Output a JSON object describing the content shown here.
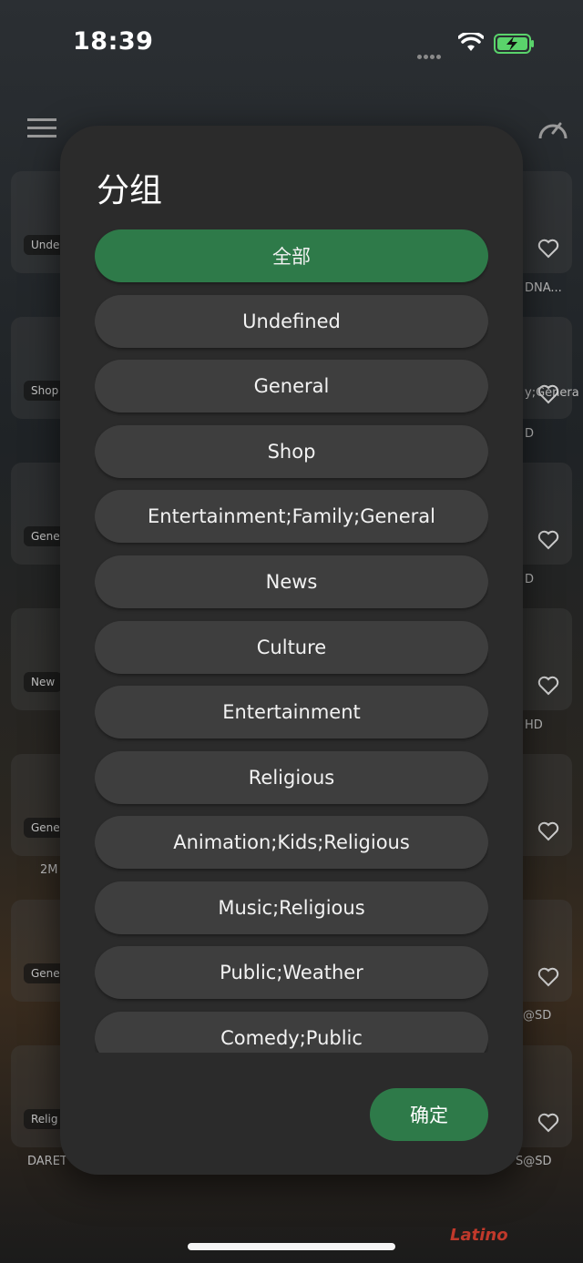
{
  "status_bar": {
    "time": "18:39"
  },
  "background": {
    "tags": [
      "Unde",
      "Shop",
      "Gene",
      "New",
      "Gene",
      "Gene",
      "Relig"
    ],
    "right_texts": [
      "DNA...",
      "y;Genera",
      "D",
      "D",
      "HD",
      "@SD",
      "S@SD"
    ],
    "left_texts": [
      "2M",
      "DARET"
    ],
    "logos": [
      "Latino"
    ]
  },
  "dialog": {
    "title": "分组",
    "options": [
      "全部",
      "Undefined",
      "General",
      "Shop",
      "Entertainment;Family;General",
      "News",
      "Culture",
      "Entertainment",
      "Religious",
      "Animation;Kids;Religious",
      "Music;Religious",
      "Public;Weather",
      "Comedy;Public"
    ],
    "selected_index": 0,
    "confirm_label": "确定"
  },
  "colors": {
    "accent": "#2e7a49",
    "dialog_bg": "#2b2b2b",
    "option_bg": "#3e3e3e"
  }
}
